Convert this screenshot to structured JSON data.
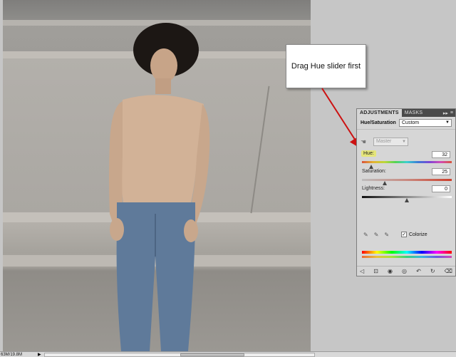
{
  "callout": {
    "text": "Drag Hue slider first"
  },
  "panel": {
    "tabs": [
      {
        "label": "ADJUSTMENTS"
      },
      {
        "label": "MASKS"
      }
    ],
    "title": "Hue/Saturation",
    "preset": "Custom",
    "channel": "Master",
    "sliders": {
      "hue": {
        "label": "Hue:",
        "value": "32"
      },
      "saturation": {
        "label": "Saturation:",
        "value": "25"
      },
      "lightness": {
        "label": "Lightness:",
        "value": "0"
      }
    },
    "colorize": {
      "label": "Colorize",
      "checked": true,
      "mark": "✓"
    },
    "footer_icons": [
      "back-icon",
      "clip-icon",
      "eye-icon",
      "previous-state-icon",
      "reset-icon",
      "trash-icon"
    ]
  },
  "statusbar": {
    "doc_size": "63M/19.8M"
  },
  "colors": {
    "arrow": "#cc1111",
    "hue_highlight": "#e5e57a"
  }
}
